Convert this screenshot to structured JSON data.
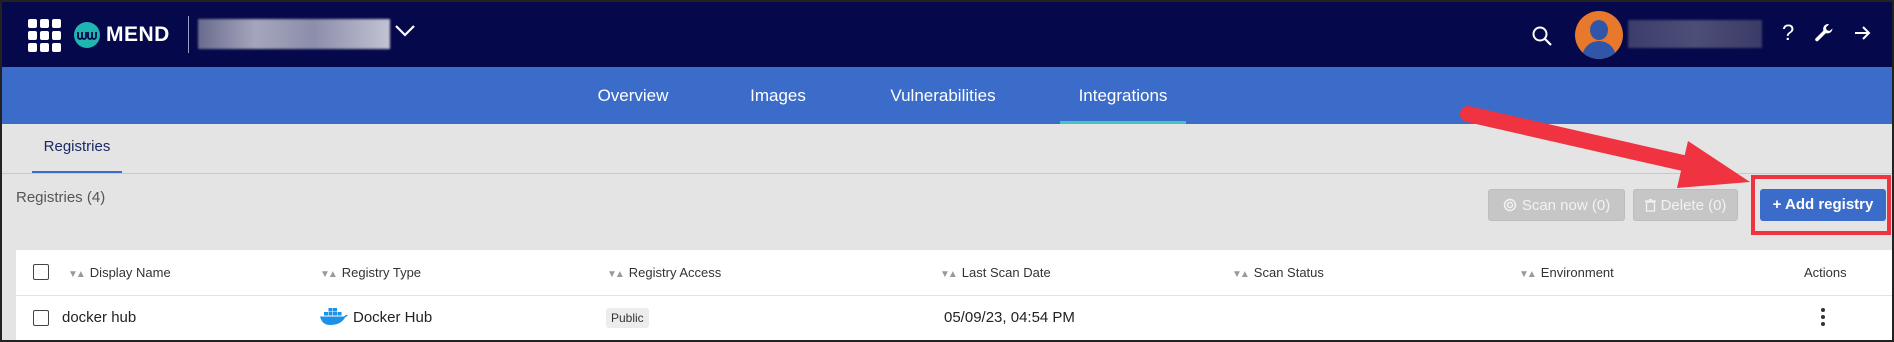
{
  "brand": {
    "name": "MEND"
  },
  "header": {
    "icons": [
      "apps-grid-icon",
      "chevron-down-icon",
      "search-icon",
      "help-icon",
      "wrench-icon",
      "logout-arrow-icon"
    ],
    "help_glyph": "?"
  },
  "nav": {
    "tabs": [
      {
        "label": "Overview"
      },
      {
        "label": "Images"
      },
      {
        "label": "Vulnerabilities"
      },
      {
        "label": "Integrations",
        "active": true
      }
    ]
  },
  "subnav": {
    "active_tab": "Registries"
  },
  "registries": {
    "count_label": "Registries (4)",
    "buttons": {
      "scan_now": "Scan now (0)",
      "delete": "Delete (0)",
      "add": "+ Add registry"
    }
  },
  "table": {
    "columns": [
      "Display Name",
      "Registry Type",
      "Registry Access",
      "Last Scan Date",
      "Scan Status",
      "Environment",
      "Actions"
    ],
    "rows": [
      {
        "display_name": "docker hub",
        "registry_type": "Docker Hub",
        "registry_type_icon": "docker-whale-icon",
        "registry_access": "Public",
        "last_scan_date": "05/09/23, 04:54 PM",
        "scan_status": "",
        "environment": ""
      }
    ]
  },
  "colors": {
    "topbar": "#05084a",
    "nav": "#3b6cc9",
    "accent_underline": "#3cc7c0",
    "annotation": "#ef3340",
    "brand_teal": "#1fb5b0"
  }
}
